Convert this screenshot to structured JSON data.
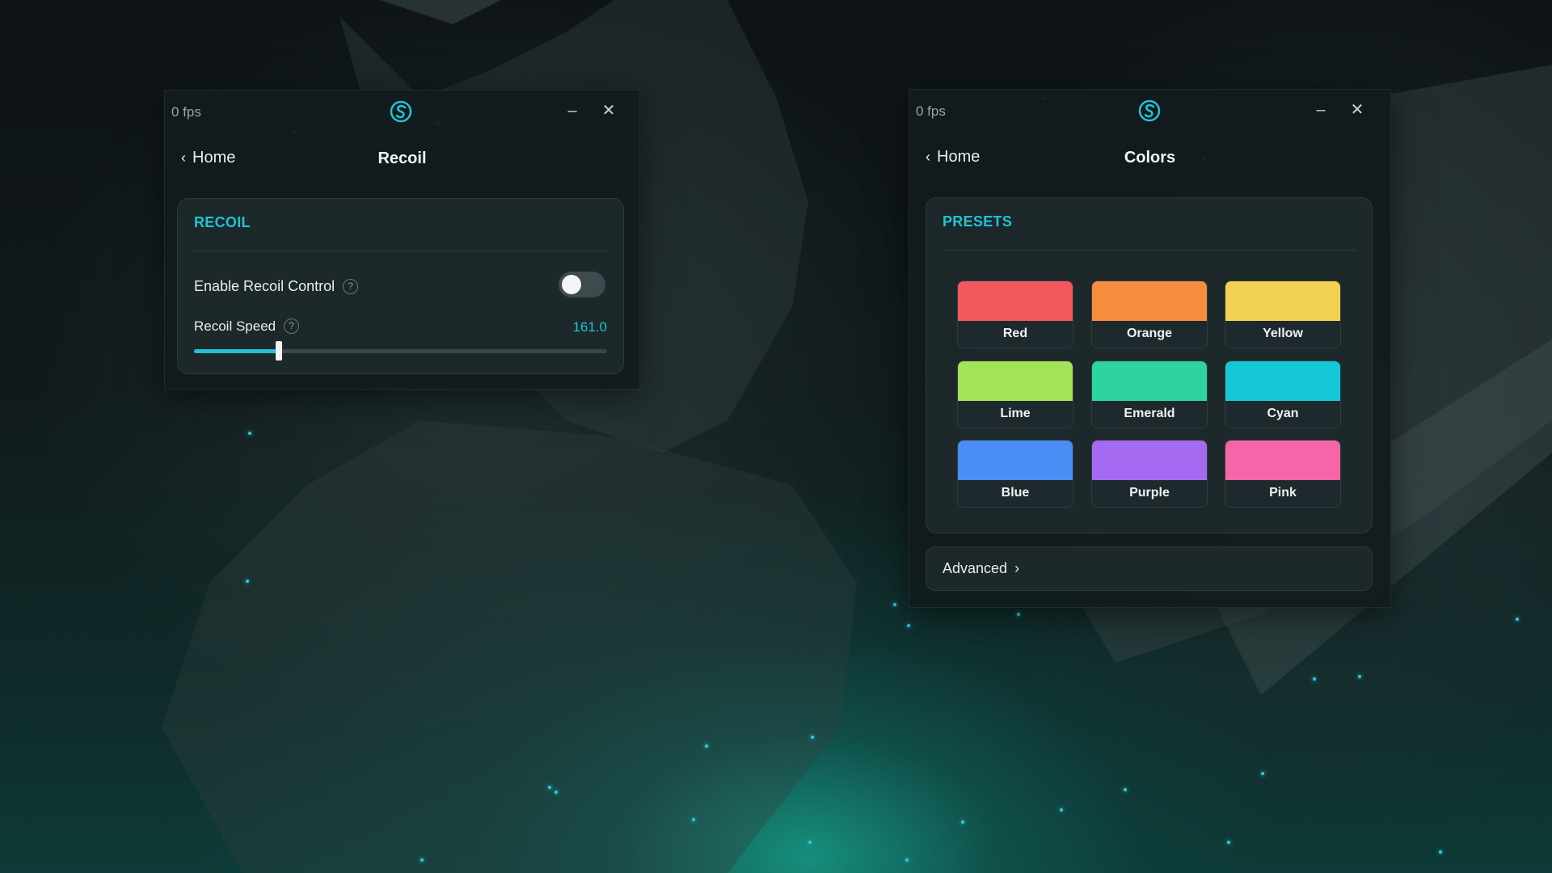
{
  "recoil_window": {
    "fps": "0 fps",
    "back_label": "Home",
    "title": "Recoil",
    "section_title": "RECOIL",
    "enable_label": "Enable Recoil Control",
    "enable_on": false,
    "speed_label": "Recoil Speed",
    "speed_value": "161.0",
    "speed_fraction": 0.205
  },
  "colors_window": {
    "fps": "0 fps",
    "back_label": "Home",
    "title": "Colors",
    "section_title": "PRESETS",
    "presets": [
      {
        "name": "Red",
        "color": "#f2585e"
      },
      {
        "name": "Orange",
        "color": "#f88c3f"
      },
      {
        "name": "Yellow",
        "color": "#f3d153"
      },
      {
        "name": "Lime",
        "color": "#a3e358"
      },
      {
        "name": "Emerald",
        "color": "#2dd3a0"
      },
      {
        "name": "Cyan",
        "color": "#15c8d8"
      },
      {
        "name": "Blue",
        "color": "#4a8df5"
      },
      {
        "name": "Purple",
        "color": "#a66af2"
      },
      {
        "name": "Pink",
        "color": "#f466a8"
      }
    ],
    "advanced_label": "Advanced"
  },
  "theme": {
    "accent": "#22c2d4"
  }
}
